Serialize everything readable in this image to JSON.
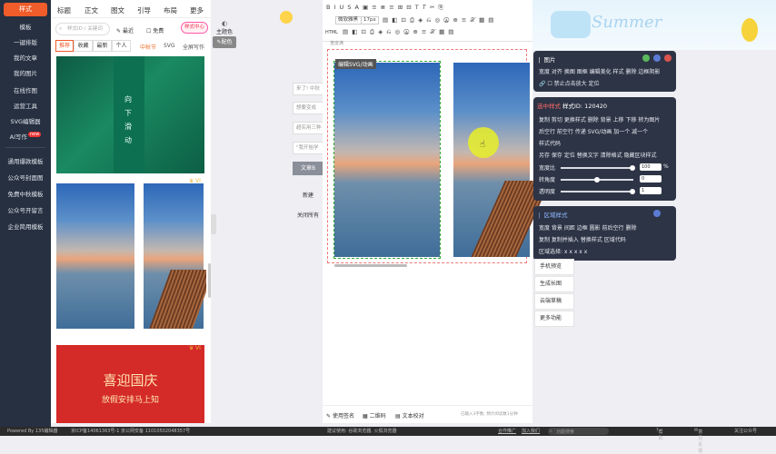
{
  "nav": {
    "logo": "样式",
    "items": [
      "模板",
      "一键排版",
      "我的文章",
      "我的图片",
      "在线作图",
      "运营工具",
      "SVG编辑器",
      "AI写作",
      "通用爆款模板",
      "公众号封面图",
      "免费中秋模板",
      "公众号开留言",
      "企业简用模板"
    ],
    "new_badge": "new"
  },
  "panel": {
    "tabs": [
      "标题",
      "正文",
      "图文",
      "引导",
      "布局",
      "更多"
    ],
    "search_placeholder": "样式ID / 关键词",
    "recent_label": "最近",
    "free_label": "免费",
    "center_pill": "样式中心",
    "filters": [
      "推荐",
      "收藏",
      "最新",
      "个人"
    ],
    "filter_links": [
      "中秋节",
      "SVG",
      "全屏写作"
    ],
    "card1_text": "向下滑动",
    "card3_title": "喜迎国庆",
    "card3_sub": "放假安排马上知",
    "vip": "VI"
  },
  "side_buttons": {
    "theme": "主题色",
    "color": "配色"
  },
  "toolbar": {
    "font": "微软雅黑",
    "size": "17px",
    "html": "HTML",
    "row1_icons": "B I U S A ▣ ≡ ≣ ≡ ⊞ ⊟ T 𝑇 ✂ ⎘",
    "row2_icons": "▤ ◧ ⊡ ⎙ ◈ ⎌ ◎ Ⓐ ⊕ ≡ 𝒳 ▦ ▤"
  },
  "quick_list": [
    "来了! 中秋",
    "想要变成",
    "超实用三种",
    "\"我开始学",
    "文章B",
    "新建",
    "关闭所有"
  ],
  "editor": {
    "tag": "编辑SVG/动画",
    "small_label": "宽度满",
    "bottom": [
      "使用签名",
      "二维码",
      "文本校对"
    ],
    "count": "已输入3字数, 预计阅读数1分钟"
  },
  "summer": {
    "text": "Summer"
  },
  "image_panel": {
    "title": "图片",
    "row1": "宽度  对齐  换图  图框  编辑美化  样式  删除  边框阴影",
    "row2": "禁止点击放大  定位"
  },
  "style_panel": {
    "title": "选中样式",
    "id": "样式ID: 120420",
    "row1": "复制  剪切  更换样式  删除  背景  上移  下移  转为图片",
    "row2": "后空行  前空行  传递  SVG/动画  加一个  减一个",
    "row3": "样式代码",
    "row4": "另存  保存  定位  替换文字  清除格式  隐藏区块样式",
    "width_label": "宽度比",
    "width_value": "100",
    "unit": "%",
    "rotate_label": "转角度",
    "rotate_value": "0",
    "opacity_label": "透明度",
    "opacity_value": "1"
  },
  "area_panel": {
    "title": "区域样式",
    "row1": "宽度  背景  间距  边框  圆影  前后空行  删除",
    "row2": "复制  复制并插入  替换样式  区域代码",
    "row3": "区域选择:  x    x    x    x    x"
  },
  "right_buttons": [
    "手机预览",
    "生成长图",
    "云端草稿",
    "更多功能"
  ],
  "status": {
    "powered": "Powered By 135编辑器",
    "icp": "京ICP备14061363号-1 京公网安备 11010502048357号",
    "suggest": "建议使用: 谷歌浏览器, 火狐浏览器",
    "cooperate": "合作推广",
    "join": "加入我们",
    "search_placeholder": "功能搜索",
    "help": "帮助",
    "feedback": "意见反馈",
    "follow": "关注公众号"
  },
  "colors": {
    "accent": "#f05c2a",
    "nav": "#263040",
    "panel_dark": "#2d3445"
  }
}
